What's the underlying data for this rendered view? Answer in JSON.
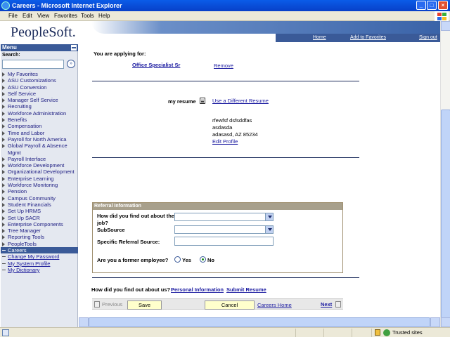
{
  "window": {
    "title": "Careers - Microsoft Internet Explorer"
  },
  "menubar": {
    "items": [
      "File",
      "Edit",
      "View",
      "Favorites",
      "Tools",
      "Help"
    ]
  },
  "header": {
    "logo": "PeopleSoft.",
    "links": {
      "home": "Home",
      "add_to_favorites": "Add to Favorites",
      "sign_out": "Sign out"
    }
  },
  "sidebar": {
    "title": "Menu",
    "search_label": "Search:",
    "items": [
      "My Favorites",
      "ASU Customizations",
      "ASU Conversion",
      "Self Service",
      "Manager Self Service",
      "Recruiting",
      "Workforce Administration",
      "Benefits",
      "Compensation",
      "Time and Labor",
      "Payroll for North America",
      "Global Payroll & Absence",
      "Mgmt",
      "Payroll Interface",
      "Workforce Development",
      "Organizational Development",
      "Enterprise Learning",
      "Workforce Monitoring",
      "Pension",
      "Campus Community",
      "Student Financials",
      "Set Up HRMS",
      "Set Up SACR",
      "Enterprise Components",
      "Tree Manager",
      "Reporting Tools",
      "PeopleTools"
    ],
    "open_item": "Careers",
    "sub_items": [
      "Change My Password",
      "My System Profile",
      "My Dictionary"
    ]
  },
  "main": {
    "applying_label": "You are applying for:",
    "job_link": "Office Specialist Sr",
    "remove_link": "Remove",
    "resume_label": "my resume",
    "different_resume_link": "Use a Different Resume",
    "address_line1": "rfewfsf dsfsddfas",
    "address_line2": "asdasda",
    "address_line3": "adasasd, AZ 85234",
    "edit_profile_link": "Edit Profile",
    "referral": {
      "title": "Referral Information",
      "how_label_line1": "How did you find out about the",
      "how_label_line2": "job?",
      "subsource_label": "SubSource",
      "specific_label": "Specific Referral Source:",
      "former_label": "Are you a former employee?",
      "yes_label": "Yes",
      "no_label": "No",
      "former_selected": "No"
    },
    "how_about_us_label": "How did you find out about us?",
    "personal_info_link": "Personal Information",
    "submit_resume_link": "Submit Resume",
    "toolbar": {
      "previous": "Previous",
      "save": "Save",
      "cancel": "Cancel",
      "careers_home": "Careers Home",
      "next": "Next"
    }
  },
  "status": {
    "zone": "Trusted sites"
  }
}
